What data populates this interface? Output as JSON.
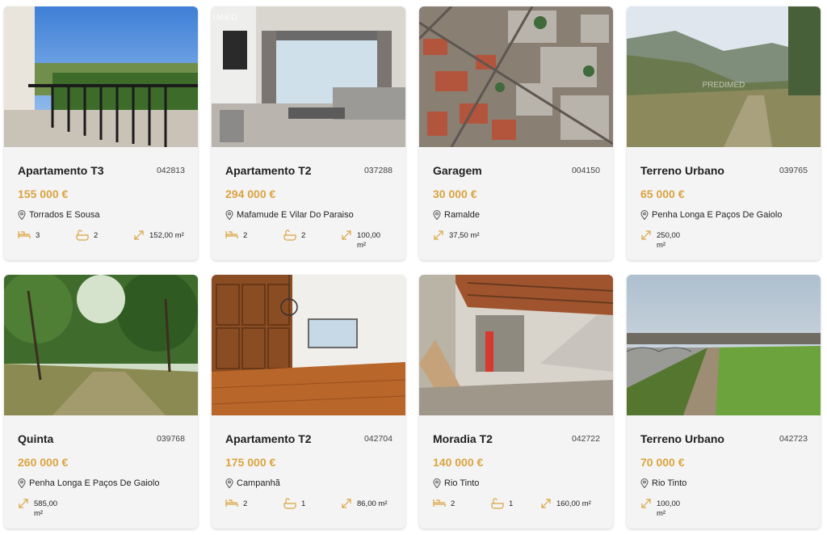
{
  "colors": {
    "accent": "#d9a441",
    "card_bg": "#f4f4f4",
    "text": "#1f1f1f",
    "icon_gold": "#d9a441"
  },
  "icons": {
    "location": "pin-icon",
    "bedrooms": "bed-icon",
    "bathrooms": "bathtub-icon",
    "area": "area-expand-icon"
  },
  "watermark": "PREDIMED",
  "listings": [
    {
      "type": "Apartamento T3",
      "ref": "042813",
      "price": "155 000 €",
      "location": "Torrados E Sousa",
      "bedrooms": "3",
      "bathrooms": "2",
      "area": "152,00 m²",
      "photo": "balcony-view"
    },
    {
      "type": "Apartamento T2",
      "ref": "037288",
      "price": "294 000 €",
      "location": "Mafamude E Vilar Do Paraiso",
      "bedrooms": "2",
      "bathrooms": "2",
      "area": "100,00 m²",
      "photo": "living-room"
    },
    {
      "type": "Garagem",
      "ref": "004150",
      "price": "30 000 €",
      "location": "Ramalde",
      "area": "37,50 m²",
      "photo": "aerial-city"
    },
    {
      "type": "Terreno Urbano",
      "ref": "039765",
      "price": "65 000 €",
      "location": "Penha Longa E Paços De Gaiolo",
      "area": "250,00 m²",
      "photo": "hillside-land"
    },
    {
      "type": "Quinta",
      "ref": "039768",
      "price": "260 000 €",
      "location": "Penha Longa E Paços De Gaiolo",
      "area": "585,00 m²",
      "photo": "woodland"
    },
    {
      "type": "Apartamento T2",
      "ref": "042704",
      "price": "175 000 €",
      "location": "Campanhã",
      "bedrooms": "2",
      "bathrooms": "1",
      "area": "86,00 m²",
      "photo": "parquet-room"
    },
    {
      "type": "Moradia T2",
      "ref": "042722",
      "price": "140 000 €",
      "location": "Rio Tinto",
      "bedrooms": "2",
      "bathrooms": "1",
      "area": "160,00 m²",
      "photo": "ruin-interior"
    },
    {
      "type": "Terreno Urbano",
      "ref": "042723",
      "price": "70 000 €",
      "location": "Rio Tinto",
      "area": "100,00 m²",
      "photo": "grass-plot"
    }
  ]
}
